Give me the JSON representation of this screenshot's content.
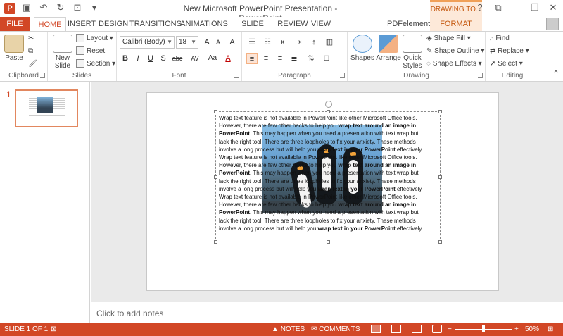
{
  "window": {
    "title": "New Microsoft PowerPoint Presentation - PowerPoint",
    "context_tab_title": "DRAWING TO...",
    "controls": [
      "?",
      "⧉",
      "—",
      "❐",
      "✕"
    ]
  },
  "tabs": {
    "file": "FILE",
    "home": "HOME",
    "insert": "INSERT",
    "design": "DESIGN",
    "transitions": "TRANSITIONS",
    "animations": "ANIMATIONS",
    "slideshow": "SLIDE SHOW",
    "review": "REVIEW",
    "view": "VIEW",
    "pdfelement": "PDFelement",
    "format": "FORMAT"
  },
  "ribbon": {
    "clipboard": {
      "label": "Clipboard",
      "paste": "Paste"
    },
    "slides": {
      "label": "Slides",
      "new_slide": "New Slide",
      "layout": "Layout",
      "reset": "Reset",
      "section": "Section"
    },
    "font": {
      "label": "Font",
      "font_name": "Calibri (Body)",
      "font_size": "18",
      "bold": "B",
      "italic": "I",
      "underline": "U",
      "shadow": "S",
      "strike": "abc",
      "spacing": "AV",
      "case": "Aa",
      "color": "A",
      "grow": "A",
      "shrink": "A",
      "clear": "A"
    },
    "paragraph": {
      "label": "Paragraph"
    },
    "drawing": {
      "label": "Drawing",
      "shapes": "Shapes",
      "arrange": "Arrange",
      "quick_styles": "Quick Styles",
      "shape_fill": "Shape Fill",
      "shape_outline": "Shape Outline",
      "shape_effects": "Shape Effects"
    },
    "editing": {
      "label": "Editing",
      "find": "Find",
      "replace": "Replace",
      "select": "Select"
    }
  },
  "slide_pane": {
    "slide_number": "1"
  },
  "slide": {
    "lines": [
      {
        "t": "Wrap text feature is not available in PowerPoint like other Microsoft Office  tools.",
        "b": ""
      },
      {
        "t": "However, there are few other hacks to help you ",
        "b": "wrap text around an image in"
      },
      {
        "t": "",
        "b": "PowerPoint",
        "t2": ". This may happen when you need a presentation with text wrap but"
      },
      {
        "t": "lack the right tool. There are three loopholes to fix your anxiety. These methods",
        "b": ""
      },
      {
        "t": "involve a long process but will help you ",
        "b": "wrap text in your PowerPoint",
        "t2": " effectively."
      },
      {
        "t": "Wrap text feature is not available in PowerPoint like other Microsoft Office tools.",
        "b": ""
      },
      {
        "t": "However, there are few other hacks to help you ",
        "b": "wrap text around an image in"
      },
      {
        "t": "",
        "b": "PowerPoint",
        "t2": ". This may happen when you need a presentation with text wrap but"
      },
      {
        "t": "lack the right tool. There are three loopholes to fix your anxiety. These methods",
        "b": ""
      },
      {
        "t": "involve a long process but will help you ",
        "b": "wrap text in your PowerPoint",
        "t2": " effectively"
      },
      {
        "t": "Wrap text feature is not available in PowerPoint like other Microsoft Office tools.",
        "b": ""
      },
      {
        "t": "However, there are few other hacks to help you ",
        "b": "wrap text around an image in"
      },
      {
        "t": "",
        "b": "PowerPoint",
        "t2": ". This may happen when you need a presentation with text wrap but"
      },
      {
        "t": "lack the right tool. There are three loopholes to fix your anxiety. These methods",
        "b": ""
      },
      {
        "t": "involve a long process but will help you ",
        "b": "wrap text in your PowerPoint",
        "t2": " effectively"
      }
    ]
  },
  "notes": {
    "placeholder": "Click to add notes"
  },
  "status": {
    "slide_info": "SLIDE 1 OF 1",
    "notes": "NOTES",
    "comments": "COMMENTS",
    "zoom": "50%",
    "zoom_fraction": 0.5
  }
}
